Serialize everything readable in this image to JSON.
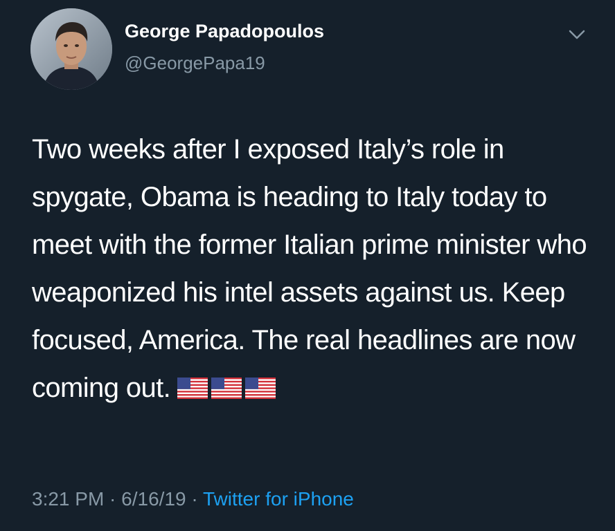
{
  "tweet": {
    "author": {
      "display_name": "George Papadopoulos",
      "handle": "@GeorgePapa19"
    },
    "text": "Two weeks after I exposed Italy’s role in spygate, Obama is heading to Italy today to meet with the former Italian prime minister who weaponized his intel assets against us. Keep focused, America. The real headlines are now coming out.",
    "emoji": [
      "us-flag-icon",
      "us-flag-icon",
      "us-flag-icon"
    ],
    "time": "3:21 PM",
    "separator": " · ",
    "date": "6/16/19",
    "source": "Twitter for iPhone"
  },
  "colors": {
    "background": "#15202b",
    "text": "#ffffff",
    "muted": "#8899a6",
    "link": "#1da1f2"
  }
}
